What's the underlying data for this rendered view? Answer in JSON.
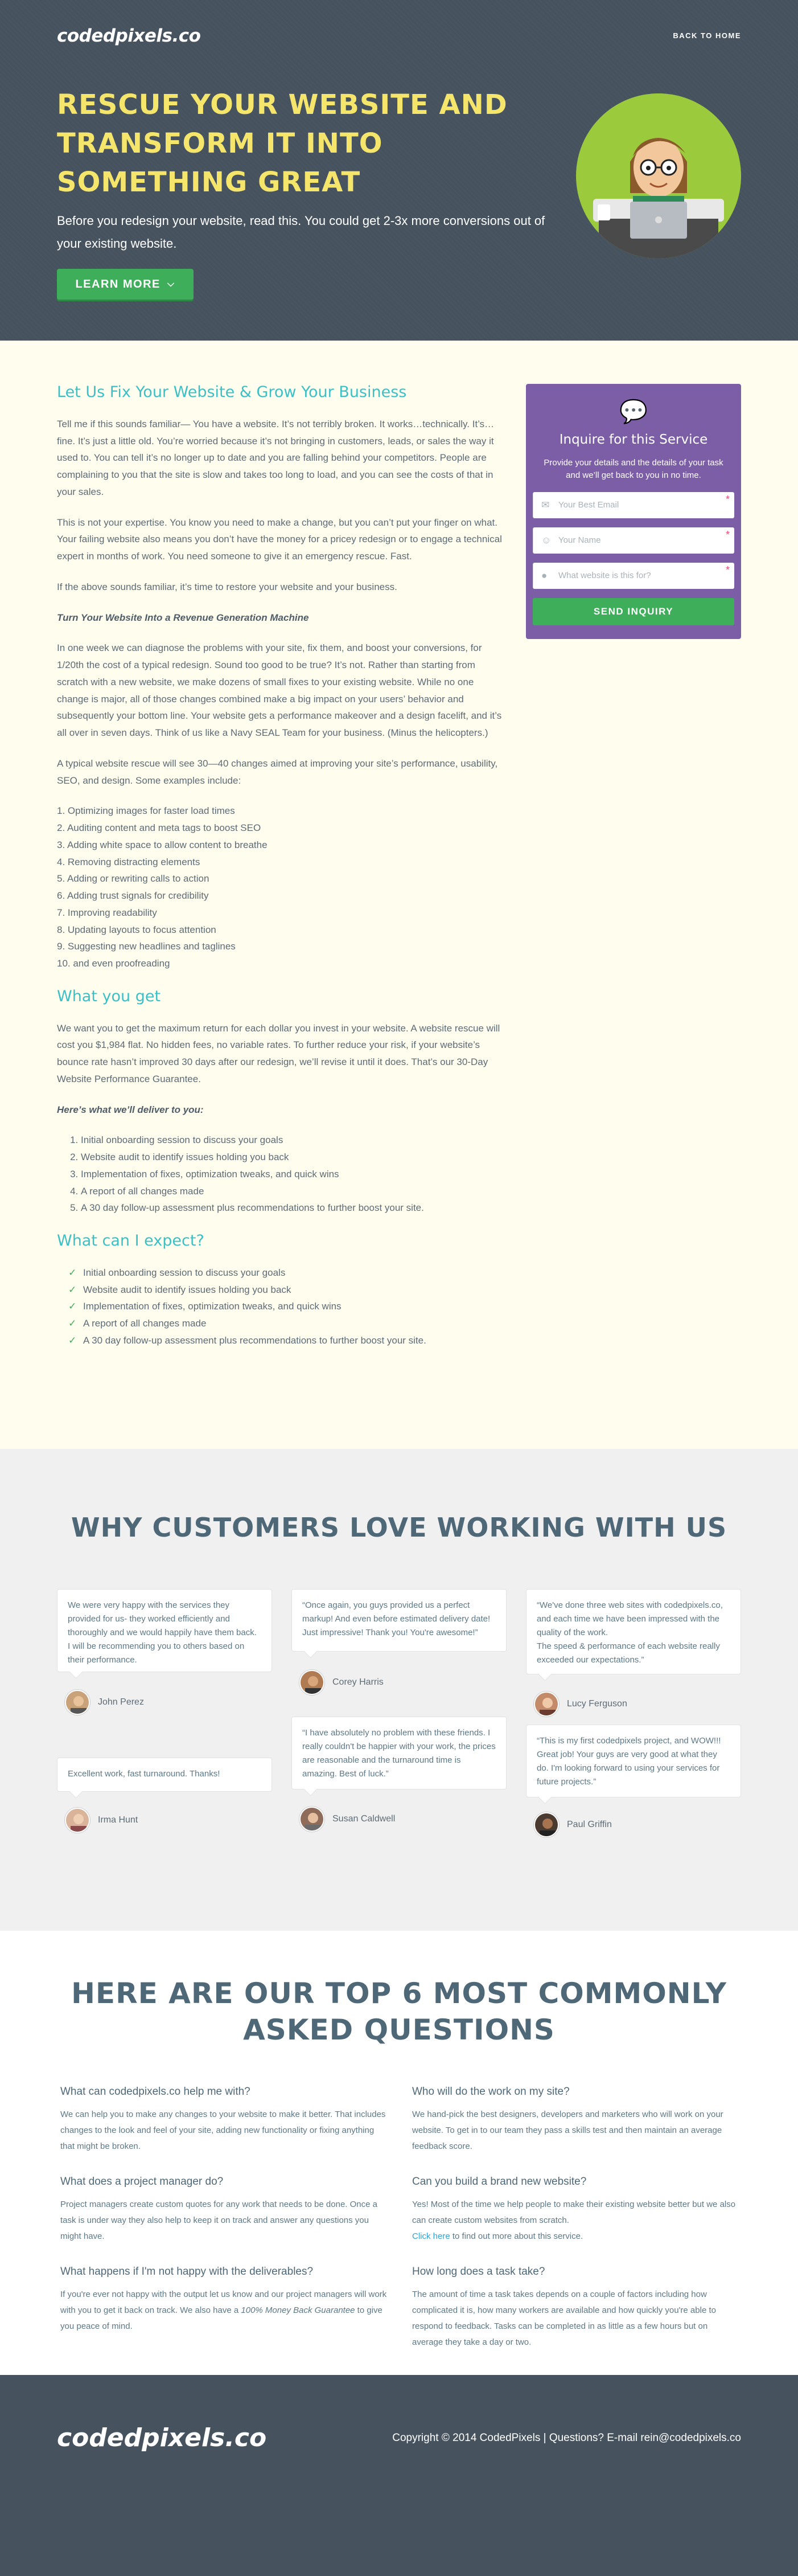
{
  "header": {
    "logo": "codedpixels.co",
    "back_link": "BACK TO HOME"
  },
  "hero": {
    "title": "RESCUE YOUR WEBSITE AND TRANSFORM IT INTO SOMETHING GREAT",
    "subtitle": "Before you redesign your website, read this. You could get 2-3x more conversions out of your existing website.",
    "cta_label": "LEARN MORE"
  },
  "main": {
    "heading1": "Let Us Fix Your Website & Grow Your Business",
    "p1": "Tell me if this sounds familiar— You have a website. It’s not terribly broken. It works…technically. It’s…fine. It’s just a little old. You’re worried because it’s not bringing in customers, leads, or sales the way it used to. You can tell it’s no longer up to date and you are falling behind your competitors. People are complaining to you that the site is slow and takes too long to load, and you can see the costs of that in your sales.",
    "p2": "This is not your expertise. You know you need to make a change, but you can’t put your finger on what. Your failing website also means you don’t have the money for a pricey redesign or to engage a technical expert in months of work. You need someone to give it an emergency rescue. Fast.",
    "p3": "If the above sounds familiar, it’s time to restore your website and your business.",
    "p4": "Turn Your Website Into a Revenue Generation Machine",
    "p5": "In one week we can diagnose the problems with your site, fix them, and boost your conversions, for 1/20th the cost of a typical redesign. Sound too good to be true? It’s not. Rather than starting from scratch with a new website, we make dozens of small fixes to your existing website. While no one change is major, all of those changes combined make a big impact on your users’ behavior and subsequently your bottom line. Your website gets a performance makeover and a design facelift, and it’s all over in seven days. Think of us like a Navy SEAL Team for your business. (Minus the helicopters.)",
    "p6": "A typical website rescue will see 30—40 changes aimed at improving your site’s performance, usability, SEO, and design. Some examples include:",
    "examples": [
      "1. Optimizing images for faster load times",
      "2. Auditing content and meta tags to boost SEO",
      "3. Adding white space to allow content to breathe",
      "4. Removing distracting elements",
      "5. Adding or rewriting calls to action",
      "6. Adding trust signals for credibility",
      "7. Improving readability",
      "8. Updating layouts to focus attention",
      "9. Suggesting new headlines and taglines",
      "10. and even proofreading"
    ],
    "heading2": "What you get",
    "p7": "We want you to get the maximum return for each dollar you invest in your website. A website rescue will cost you $1,984 flat. No hidden fees, no variable rates. To further reduce your risk, if your website’s bounce rate hasn’t improved 30 days after our redesign, we’ll revise it until it does. That’s our 30-Day Website Performance Guarantee.",
    "p8": "Here’s what we’ll deliver to you:",
    "deliver": [
      "Initial onboarding session to discuss your goals",
      "Website audit to identify issues holding you back",
      "Implementation of fixes, optimization tweaks, and quick wins",
      "A report of all changes made",
      "A 30 day follow-up assessment plus recommendations to further boost your site."
    ],
    "heading3": "What can I expect?",
    "expect": [
      "Initial onboarding session to discuss your goals",
      "Website audit to identify issues holding you back",
      "Implementation of fixes, optimization tweaks, and quick wins",
      "A report of all changes made",
      "A 30 day follow-up assessment plus recommendations to further boost your site."
    ]
  },
  "form": {
    "title": "Inquire for this Service",
    "desc": "Provide your details and the details of your task and we’ll get back to you in no time.",
    "email_placeholder": "Your Best Email",
    "name_placeholder": "Your Name",
    "website_placeholder": "What website is this for?",
    "submit": "SEND INQUIRY"
  },
  "testimonials": {
    "title": "WHY CUSTOMERS LOVE WORKING WITH US",
    "items": [
      {
        "quote": "We were very happy with the services they provided for us- they worked efficiently and thoroughly and we would happily have them back. I will be recommending you to others based on their performance.",
        "name": "John Perez"
      },
      {
        "quote": "Excellent work, fast turnaround. Thanks!",
        "name": "Irma Hunt"
      },
      {
        "quote": "“Once again, you guys provided us a perfect markup!  And even before estimated delivery date! Just impressive! Thank you! You're awesome!”",
        "name": "Corey Harris"
      },
      {
        "quote": "“I have absolutely no problem with these friends.  I really couldn't be happier with your work, the prices are reasonable and the turnaround time is amazing. Best of luck.”",
        "name": "Susan Caldwell"
      },
      {
        "quote": "“We've done three web sites with codedpixels.co, and each time we have been impressed with the quality of the work.\nThe speed & performance of each website really exceeded our expectations.”",
        "name": "Lucy Ferguson"
      },
      {
        "quote": "“This is my first codedpixels project, and WOW!!!  Great job! Your guys are very good at what they do. I'm looking forward to using your services for future projects.”",
        "name": "Paul Griffin"
      }
    ]
  },
  "faq": {
    "title": "HERE ARE OUR TOP 6 MOST COMMONLY ASKED QUESTIONS",
    "items": [
      {
        "q": "What can codedpixels.co help me with?",
        "a": "We can help you to make any changes to your website to make it better. That includes changes to the look and feel of your site, adding new functionality or fixing anything that might be broken."
      },
      {
        "q": "What does a project manager do?",
        "a": "Project managers create custom quotes for any work that needs to be done. Once a task is under way they also help to keep it on track and answer any questions you might have."
      },
      {
        "q": "What happens if I'm not happy with the deliverables?",
        "a1": "If you're ever not happy with the output let us know and our project managers will work with you to get it back on track. We also have a ",
        "a_link": "100% Money Back Guarantee",
        "a2": " to give you peace of mind."
      },
      {
        "q": "Who will do the work on my site?",
        "a": "We hand-pick the best designers, developers and marketers who will work on your website. To get in to our team they pass a skills test and then maintain an average feedback score."
      },
      {
        "q": "Can you build a brand new website?",
        "a": "Yes! Most of the time we help people to make their existing website better but we also can create custom websites from scratch.",
        "link": "Click here",
        "a_after": " to find out more about this service."
      },
      {
        "q": "How long does a task take?",
        "a": "The amount of time a task takes depends on a couple of factors including how complicated it is, how many workers are available and how quickly you're able to respond to feedback. Tasks can be completed in as little as a few hours but on average they take a day or two."
      }
    ]
  },
  "footer": {
    "logo": "codedpixels.co",
    "copyright": "Copyright © 2014 CodedPixels | Questions? E-mail rein@codedpixels.co"
  }
}
